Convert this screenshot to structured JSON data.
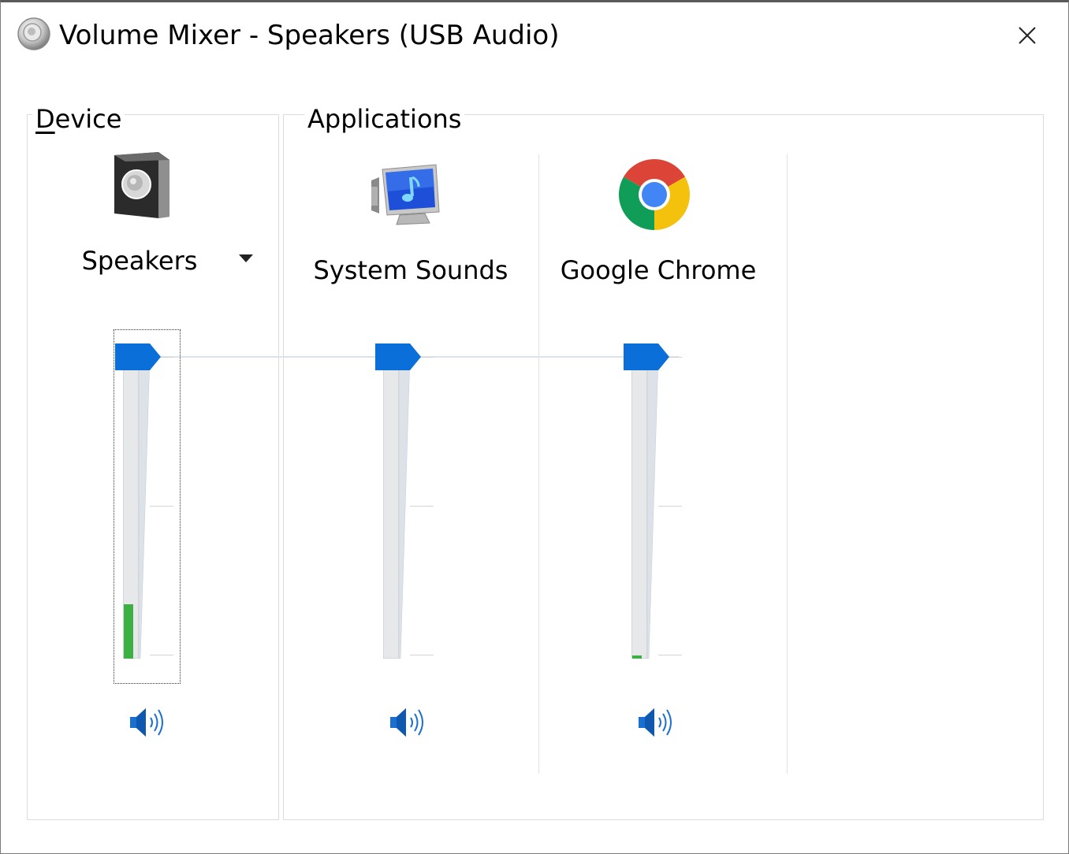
{
  "window": {
    "title": "Volume Mixer - Speakers (USB Audio)",
    "icon": "speaker-icon",
    "close_icon": "close-icon"
  },
  "device_group": {
    "label_prefix": "",
    "label_accel": "D",
    "label_rest": "evice",
    "device": {
      "name": "Speakers",
      "icon": "speaker-box-icon",
      "volume": 100,
      "peak_meter": 18,
      "mute_icon": "volume-icon"
    }
  },
  "apps_group": {
    "label": "Applications",
    "apps": [
      {
        "name": "System Sounds",
        "icon": "system-sounds-icon",
        "volume": 100,
        "peak_meter": 0,
        "mute_icon": "volume-icon"
      },
      {
        "name": "Google Chrome",
        "icon": "chrome-icon",
        "volume": 100,
        "peak_meter": 1,
        "mute_icon": "volume-icon"
      }
    ]
  },
  "colors": {
    "thumb": "#0a6fd8",
    "meter": "#3cb043",
    "speaker_blue": "#1a6fd1"
  }
}
